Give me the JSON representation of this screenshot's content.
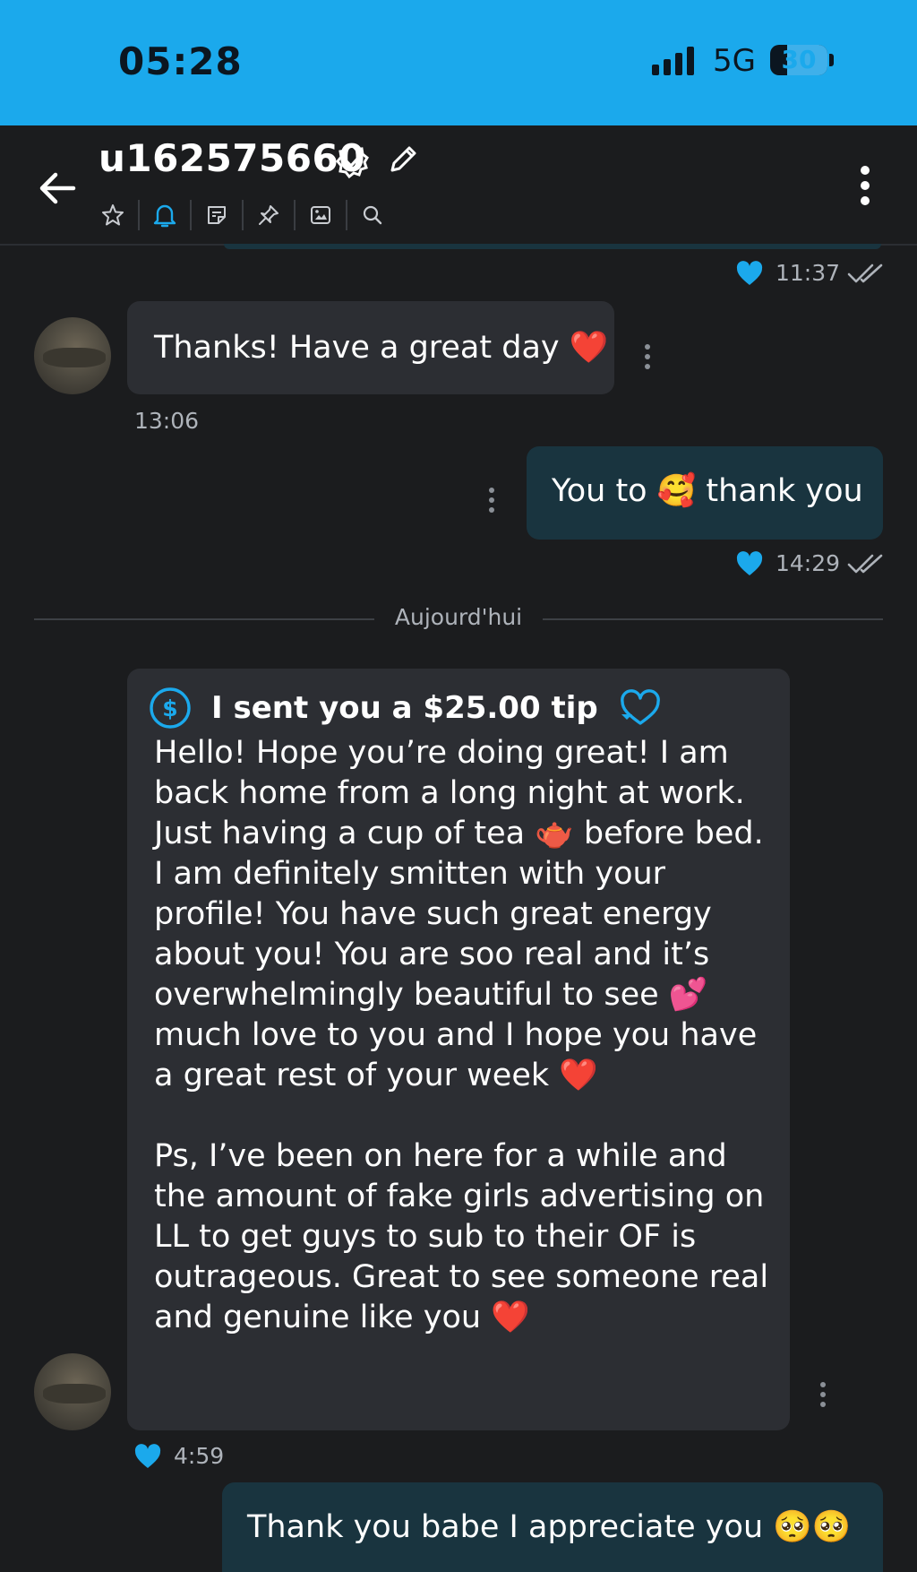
{
  "status_bar": {
    "time": "05:28",
    "network": "5G",
    "battery": "30"
  },
  "header": {
    "title": "u162575660",
    "tools": [
      "star-icon",
      "bell-icon",
      "note-icon",
      "pin-icon",
      "image-icon",
      "search-icon"
    ]
  },
  "messages": {
    "top_time": "11:37",
    "m1": {
      "text": "Thanks! Have a great day ❤️",
      "time": "13:06"
    },
    "m2": {
      "text": "You to 🥰 thank you",
      "time": "14:29"
    },
    "day_separator": "Aujourd'hui",
    "tip": {
      "header": "I sent you a $25.00 tip",
      "body": "Hello! Hope you’re doing great! I am back home from a long night at work. Just having a cup of tea 🫖 before bed. I am definitely smitten with your profile! You have such great energy about you! You are soo real and it’s overwhelmingly beautiful to see 💕 much love to you and I hope you have a great rest of your week ❤️\n\nPs, I’ve been on here for a while and the amount of fake girls advertising on LL to get guys to sub to their OF is outrageous. Great to see someone real and genuine like you ❤️",
      "time": "4:59"
    },
    "m3": {
      "text": "Thank you babe I appreciate you 🥺🥺"
    }
  },
  "colors": {
    "status_bar": "#1ba9ec",
    "background": "#1b1c1e",
    "incoming_bubble": "#2c2e33",
    "outgoing_bubble": "#19343f",
    "accent": "#1ba9ec"
  }
}
